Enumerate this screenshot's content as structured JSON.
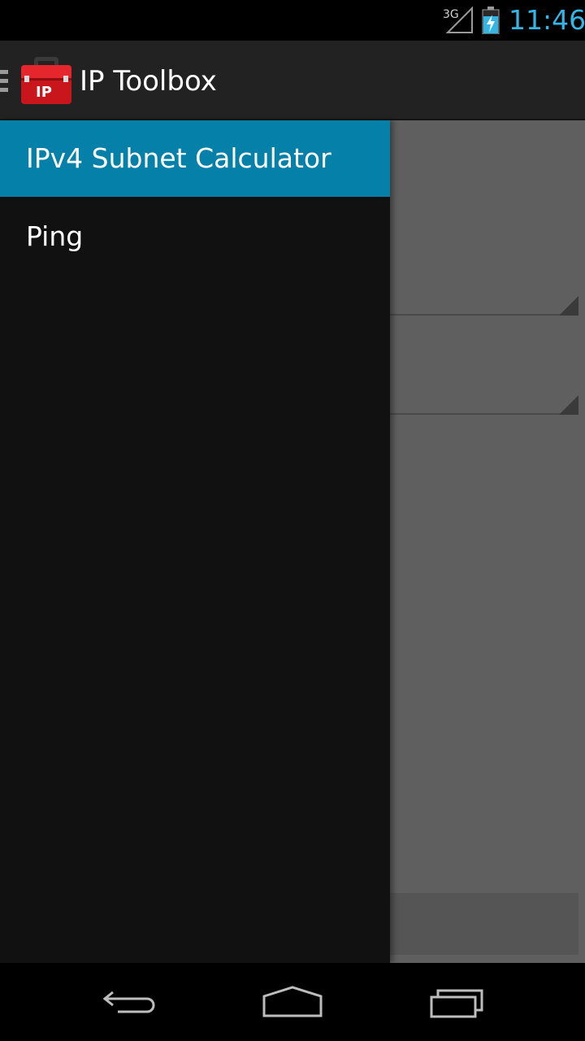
{
  "status_bar": {
    "network": "3G",
    "time": "11:46",
    "signal_icon": "signal-icon",
    "battery_icon": "battery-charging-icon"
  },
  "action_bar": {
    "title": "IP Toolbox",
    "icon": "toolbox-icon",
    "icon_text": "IP"
  },
  "drawer": {
    "items": [
      {
        "label": "IPv4 Subnet Calculator",
        "selected": true
      },
      {
        "label": "Ping",
        "selected": false
      }
    ]
  },
  "nav_bar": {
    "back_icon": "back-icon",
    "home_icon": "home-icon",
    "recents_icon": "recents-icon"
  },
  "colors": {
    "accent": "#33b5e5",
    "selected": "#0580a8",
    "drawer_bg": "#111111",
    "action_bar_bg": "#222222"
  }
}
